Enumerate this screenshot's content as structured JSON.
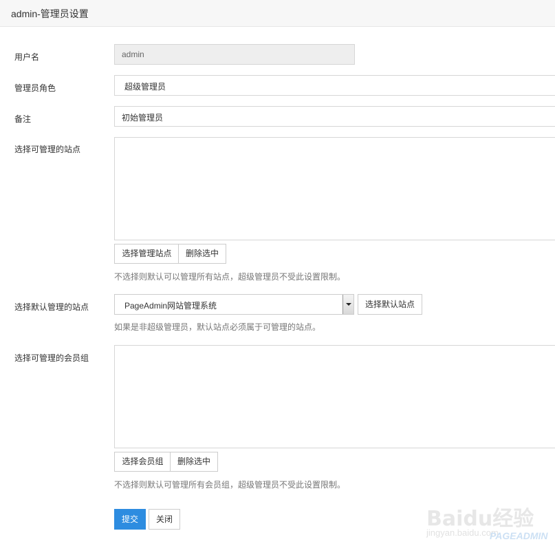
{
  "header": {
    "title": "admin-管理员设置"
  },
  "form": {
    "username": {
      "label": "用户名",
      "value": "admin"
    },
    "role": {
      "label": "管理员角色",
      "value": "超级管理员"
    },
    "remark": {
      "label": "备注",
      "value": "初始管理员"
    },
    "sites": {
      "label": "选择可管理的站点",
      "select_button": "选择管理站点",
      "delete_button": "删除选中",
      "hint": "不选择则默认可以管理所有站点，超级管理员不受此设置限制。"
    },
    "default_site": {
      "label": "选择默认管理的站点",
      "selected": "PageAdmin网站管理系统",
      "button": "选择默认站点",
      "hint": "如果是非超级管理员，默认站点必须属于可管理的站点。"
    },
    "member_groups": {
      "label": "选择可管理的会员组",
      "select_button": "选择会员组",
      "delete_button": "删除选中",
      "hint": "不选择则默认可管理所有会员组，超级管理员不受此设置限制。"
    }
  },
  "actions": {
    "submit": "提交",
    "close": "关闭"
  },
  "watermark": {
    "brand": "Baidu经验",
    "url": "jingyan.baidu.com",
    "product": "PAGEADMIN"
  },
  "colors": {
    "primary": "#2d8ce0",
    "header_bg": "#f7f7f7",
    "readonly_bg": "#eeeeee"
  }
}
